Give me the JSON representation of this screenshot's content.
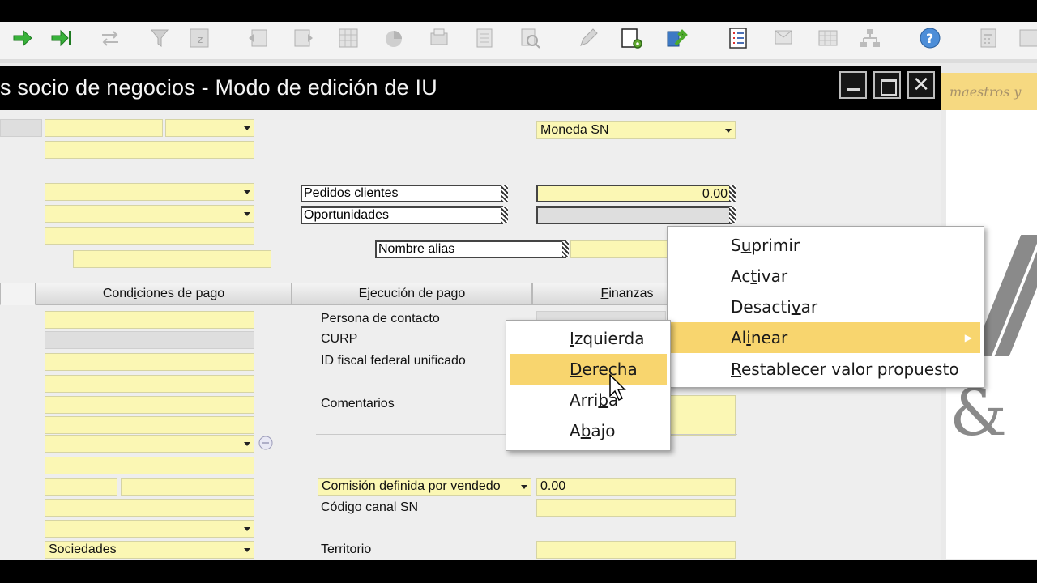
{
  "window": {
    "title": "s socio de negocios - Modo de edición de IU"
  },
  "right_panel": {
    "tab_text": "maestros y"
  },
  "fields": {
    "moneda_sn": "Moneda SN",
    "pedidos_clientes_value": "0.00",
    "comision_value": "0.00",
    "sociedades": "Sociedades"
  },
  "labels": {
    "pedidos_clientes": "Pedidos clientes",
    "oportunidades": "Oportunidades",
    "nombre_alias": "Nombre alias",
    "persona_contacto": "Persona de contacto",
    "curp": "CURP",
    "id_fiscal": "ID fiscal federal unificado",
    "comentarios": "Comentarios",
    "comision": "Comisión definida por vendedo",
    "codigo_canal": "Código canal SN",
    "territorio": "Territorio"
  },
  "tabs": [
    {
      "pre": "Cond",
      "u": "i",
      "post": "ciones de pago"
    },
    {
      "pre": "E",
      "u": "j",
      "post": "ecución de pago"
    },
    {
      "pre": "",
      "u": "F",
      "post": "inanzas"
    }
  ],
  "context_menu": {
    "items": [
      {
        "pre": "S",
        "u": "u",
        "post": "primir"
      },
      {
        "pre": "Ac",
        "u": "t",
        "post": "ivar"
      },
      {
        "pre": "Desacti",
        "u": "v",
        "post": "ar"
      },
      {
        "pre": "Al",
        "u": "i",
        "post": "near"
      },
      {
        "pre": "",
        "u": "R",
        "post": "establecer valor propuesto"
      }
    ],
    "highlighted": "Alinear"
  },
  "submenu": {
    "items": [
      {
        "pre": "",
        "u": "I",
        "post": "zquierda"
      },
      {
        "pre": "",
        "u": "D",
        "post": "erecha"
      },
      {
        "pre": "Arri",
        "u": "b",
        "post": "a"
      },
      {
        "pre": "A",
        "u": "b",
        "post": "ajo"
      }
    ],
    "highlighted": "Derecha"
  },
  "colors": {
    "field_yellow": "#fbf7b4",
    "menu_highlight": "#f8d56e",
    "titlebar": "#000000"
  }
}
